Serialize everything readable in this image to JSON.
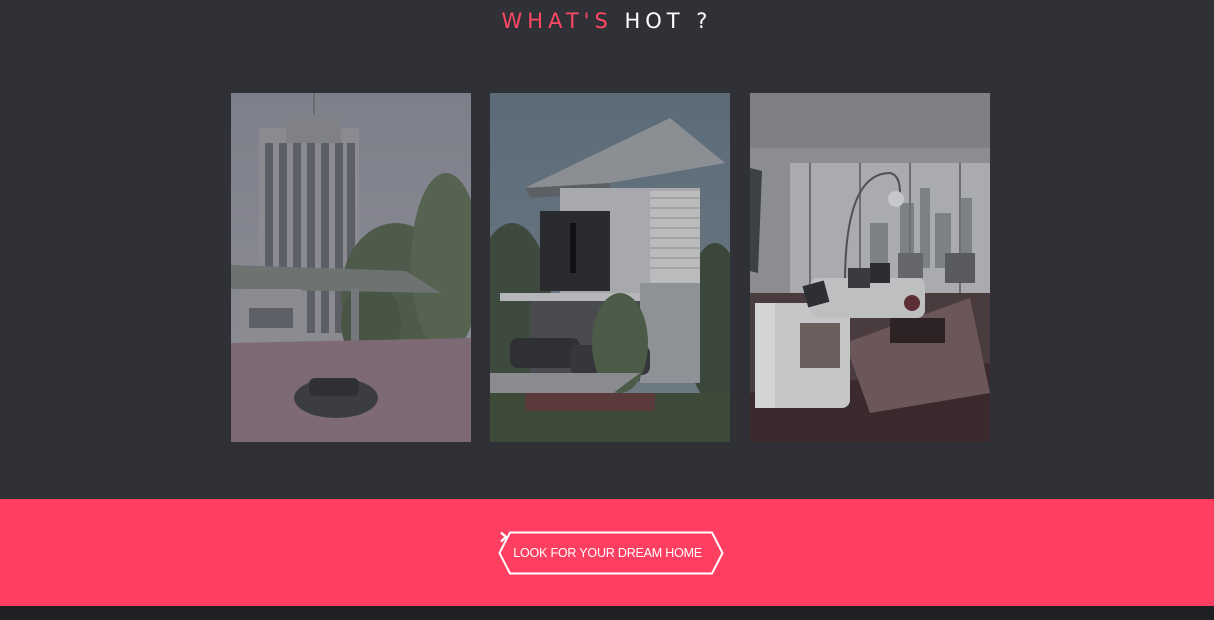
{
  "section": {
    "title_accent": "WHAT'S",
    "title_rest": "HOT ?"
  },
  "cards": [
    {
      "subject": "condominium tower with guardhouse entrance",
      "icon": "building-photo"
    },
    {
      "subject": "modern two-storey house with carport",
      "icon": "house-photo"
    },
    {
      "subject": "bright living room with city view",
      "icon": "interior-photo"
    }
  ],
  "cta": {
    "label": "LOOK FOR YOUR DREAM HOME",
    "icon": "chevron-right-icon"
  },
  "colors": {
    "background": "#303137",
    "accent": "#ff3f61",
    "title_accent": "#ff4766",
    "footer": "#1f2023"
  }
}
